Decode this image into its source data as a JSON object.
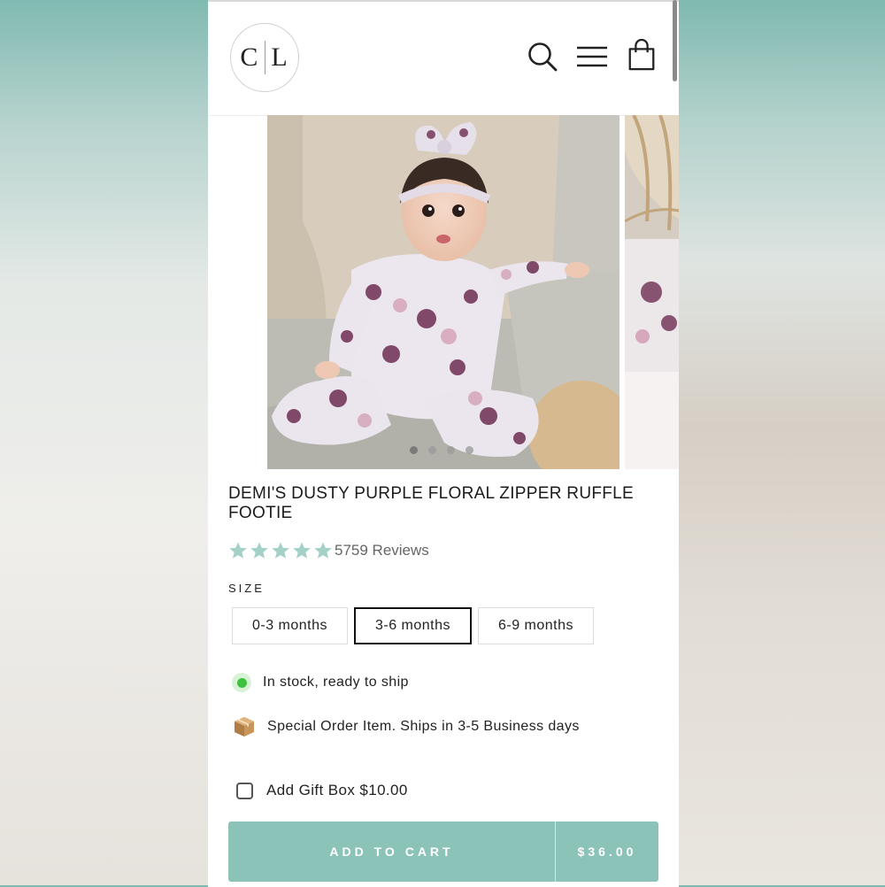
{
  "logo": {
    "left": "C",
    "right": "L"
  },
  "header": {
    "icons": [
      "search-icon",
      "menu-icon",
      "cart-icon"
    ]
  },
  "gallery": {
    "dots_count": 4,
    "active_dot": 1
  },
  "product": {
    "title": "DEMI'S DUSTY PURPLE FLORAL ZIPPER RUFFLE FOOTIE",
    "rating_stars": 5,
    "reviews_text": "5759 Reviews",
    "size_label": "SIZE",
    "sizes": [
      "0-3 months",
      "3-6 months",
      "6-9 months"
    ],
    "selected_size": "3-6 months",
    "stock_text": "In stock, ready to ship",
    "special_text": "Special Order Item. Ships in 3-5 Business days",
    "gift_text": "Add Gift Box $10.00",
    "gift_checked": false,
    "add_to_cart": "ADD TO CART",
    "price": "$36.00"
  },
  "colors": {
    "accent": "#8bc3b8",
    "star": "#a3d1c7",
    "stock_green": "#3ec13e"
  }
}
